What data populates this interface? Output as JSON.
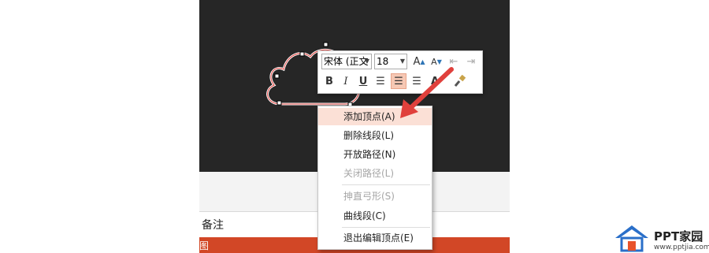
{
  "colors": {
    "slide_bg": "#262626",
    "accent": "#d24726",
    "arrow": "#e0403c",
    "menu_hover": "#fbe0d6"
  },
  "notes": {
    "label": "备注"
  },
  "status": {
    "text": "图"
  },
  "toolbar": {
    "font_name": "宋体 (正文",
    "font_size": "18",
    "bold": "B",
    "italic": "I",
    "underline": "U",
    "grow_font": "A",
    "shrink_font": "A",
    "font_color": "A"
  },
  "menu": {
    "items": [
      {
        "label": "添加顶点(A)",
        "state": "hover"
      },
      {
        "label": "删除线段(L)",
        "state": "normal"
      },
      {
        "label": "开放路径(N)",
        "state": "normal"
      },
      {
        "label": "关闭路径(L)",
        "state": "disabled"
      },
      {
        "label": "抻直弓形(S)",
        "state": "disabled"
      },
      {
        "label": "曲线段(C)",
        "state": "normal"
      },
      {
        "label": "退出编辑顶点(E)",
        "state": "normal"
      }
    ]
  },
  "logo": {
    "title": "PPT家园",
    "url": "www.pptjia.com"
  }
}
